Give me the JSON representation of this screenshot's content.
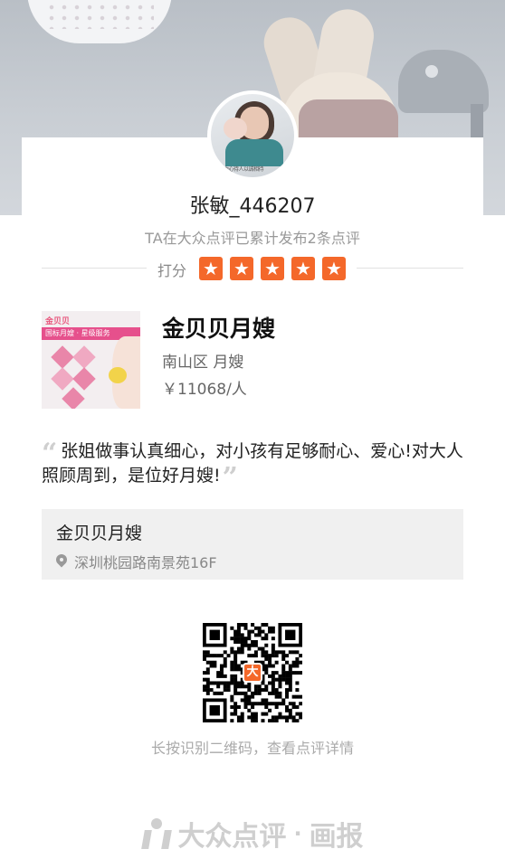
{
  "user": {
    "name": "张敏_446207",
    "summary": "TA在大众点评已累计发布2条点评",
    "avatar_signature": "由心待人以诚相待"
  },
  "rating": {
    "label": "打分",
    "stars": 5,
    "max_stars": 5,
    "star_color": "#f4682a"
  },
  "shop": {
    "name": "金贝贝月嫂",
    "category": "南山区 月嫂",
    "price": "￥11068/人",
    "image_logo": "金贝贝",
    "image_banner": "国标月嫂 · 星级服务"
  },
  "review": {
    "text": "张姐做事认真细心，对小孩有足够耐心、爱心!对大人照顾周到，是位好月嫂!"
  },
  "address": {
    "name": "金贝贝月嫂",
    "location": "深圳桃园路南景苑16F",
    "icon": "location-pin-icon"
  },
  "qr": {
    "hint": "长按识别二维码，查看点评详情"
  },
  "brand": {
    "name": "大众点评",
    "separator": "·",
    "product": "画报"
  }
}
